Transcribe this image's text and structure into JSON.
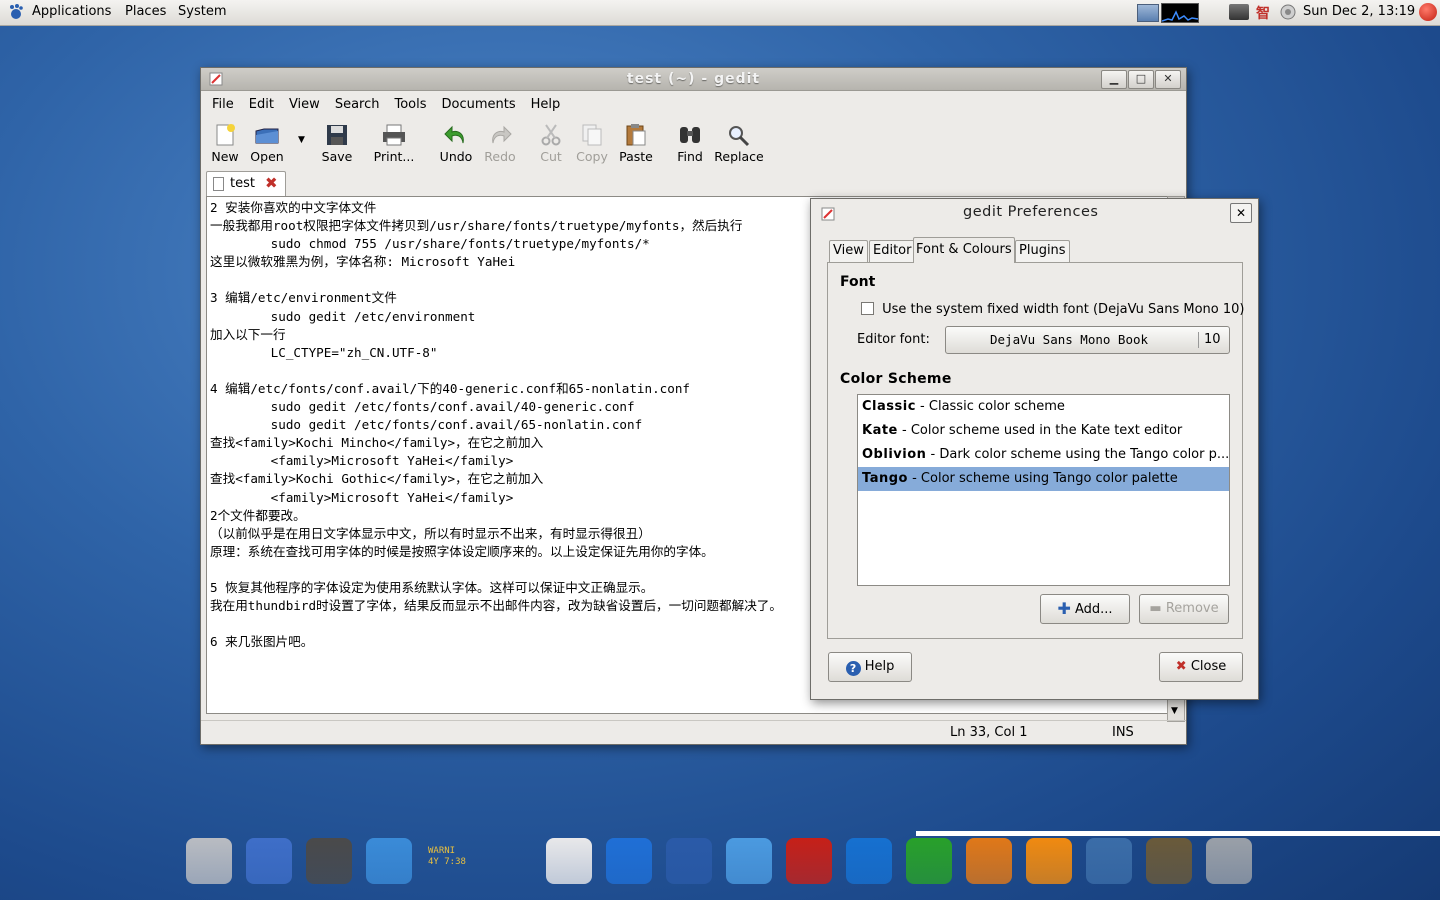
{
  "top_panel": {
    "menus": [
      "Applications",
      "Places",
      "System"
    ],
    "clock": "Sun Dec  2, 13:19",
    "ime_indicator": "智"
  },
  "gedit": {
    "title": "test (~) - gedit",
    "menus": [
      "File",
      "Edit",
      "View",
      "Search",
      "Tools",
      "Documents",
      "Help"
    ],
    "toolbar": [
      {
        "label": "New",
        "icon": "new-document-icon",
        "enabled": true
      },
      {
        "label": "Open",
        "icon": "open-folder-icon",
        "enabled": true
      },
      {
        "label": "Save",
        "icon": "floppy-disk-icon",
        "enabled": true
      },
      {
        "label": "Print...",
        "icon": "printer-icon",
        "enabled": true
      },
      {
        "label": "Undo",
        "icon": "undo-arrow-icon",
        "enabled": true
      },
      {
        "label": "Redo",
        "icon": "redo-arrow-icon",
        "enabled": false
      },
      {
        "label": "Cut",
        "icon": "scissors-icon",
        "enabled": false
      },
      {
        "label": "Copy",
        "icon": "copy-icon",
        "enabled": false
      },
      {
        "label": "Paste",
        "icon": "clipboard-icon",
        "enabled": true
      },
      {
        "label": "Find",
        "icon": "binoculars-icon",
        "enabled": true
      },
      {
        "label": "Replace",
        "icon": "magnifier-icon",
        "enabled": true
      }
    ],
    "tab_label": "test",
    "text_lines": [
      "2 安装你喜欢的中文字体文件",
      "一般我都用root权限把字体文件拷贝到/usr/share/fonts/truetype/myfonts，然后执行",
      "        sudo chmod 755 /usr/share/fonts/truetype/myfonts/*",
      "这里以微软雅黑为例，字体名称: Microsoft YaHei",
      "",
      "3 编辑/etc/environment文件",
      "        sudo gedit /etc/environment",
      "加入以下一行",
      "        LC_CTYPE=\"zh_CN.UTF-8\"",
      "",
      "4 编辑/etc/fonts/conf.avail/下的40-generic.conf和65-nonlatin.conf",
      "        sudo gedit /etc/fonts/conf.avail/40-generic.conf",
      "        sudo gedit /etc/fonts/conf.avail/65-nonlatin.conf",
      "查找<family>Kochi Mincho</family>，在它之前加入",
      "        <family>Microsoft YaHei</family>",
      "查找<family>Kochi Gothic</family>，在它之前加入",
      "        <family>Microsoft YaHei</family>",
      "2个文件都要改。",
      "（以前似乎是在用日文字体显示中文，所以有时显示不出来，有时显示得很丑）",
      "原理：系统在查找可用字体的时候是按照字体设定顺序来的。以上设定保证先用你的字体。",
      "",
      "5 恢复其他程序的字体设定为使用系统默认字体。这样可以保证中文正确显示。",
      "我在用thundbird时设置了字体，结果反而显示不出邮件内容，改为缺省设置后，一切问题都解决了。",
      "",
      "6 来几张图片吧。"
    ],
    "status": {
      "position": "Ln 33, Col 1",
      "mode": "INS"
    }
  },
  "prefs": {
    "title": "gedit Preferences",
    "tabs": [
      "View",
      "Editor",
      "Font & Colours",
      "Plugins"
    ],
    "font_section": "Font",
    "system_font_checkbox": "Use the system fixed width font (DejaVu Sans Mono 10)",
    "system_font_checked": false,
    "editor_font_label": "Editor font:",
    "editor_font_name": "DejaVu Sans Mono Book",
    "editor_font_size": "10",
    "scheme_section": "Color Scheme",
    "schemes": [
      {
        "name": "Classic",
        "desc": " - Classic color scheme"
      },
      {
        "name": "Kate",
        "desc": " - Color scheme used in the Kate text editor"
      },
      {
        "name": "Oblivion",
        "desc": " - Dark color scheme using the Tango color p..."
      },
      {
        "name": "Tango",
        "desc": " - Color scheme using Tango color palette"
      }
    ],
    "selected_scheme": "Tango",
    "add_label": "Add...",
    "remove_label": "Remove",
    "help_label": "Help",
    "close_label": "Close"
  },
  "dock": {
    "apps": [
      "hard-disk",
      "editor",
      "camera",
      "media-player",
      "console-log",
      "terminal",
      "text-editor",
      "web-browser",
      "mail",
      "chat",
      "filezilla",
      "word-processor",
      "spreadsheet",
      "presentation",
      "vlc",
      "network",
      "gimp",
      "trash"
    ],
    "console_text": "WARNI\n4Y 7:38 F"
  },
  "colors": {
    "selection": "#86abd9",
    "desktop": "#2f64a8"
  }
}
